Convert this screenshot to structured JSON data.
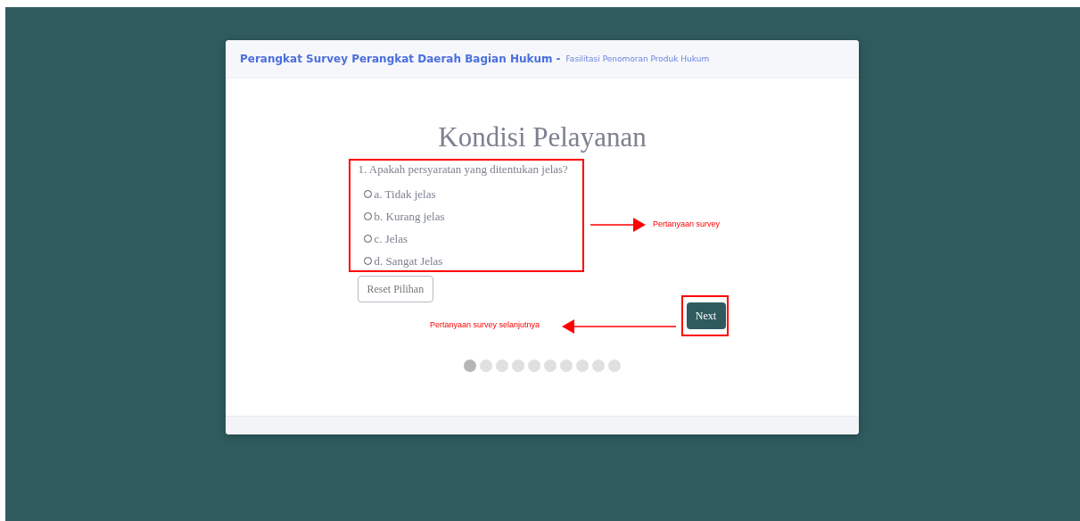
{
  "header": {
    "title": "Perangkat Survey Perangkat Daerah Bagian Hukum",
    "separator": "-",
    "subtitle": "Fasilitasi Penomoran Produk Hukum"
  },
  "section_title": "Kondisi Pelayanan",
  "question": {
    "text": "1. Apakah persyaratan yang ditentukan jelas?",
    "options": [
      {
        "label": "a. Tidak jelas",
        "selected": false
      },
      {
        "label": "b. Kurang jelas",
        "selected": false
      },
      {
        "label": "c. Jelas",
        "selected": false
      },
      {
        "label": "d. Sangat Jelas",
        "selected": false
      }
    ]
  },
  "reset_button": "Reset Pilihan",
  "next_button": "Next",
  "steps": [
    {
      "selected": true
    },
    {
      "selected": false
    },
    {
      "selected": false
    },
    {
      "selected": false
    },
    {
      "selected": false
    },
    {
      "selected": false
    },
    {
      "selected": false
    },
    {
      "selected": false
    },
    {
      "selected": false
    },
    {
      "selected": false
    }
  ],
  "annotations": [
    {
      "kind": "question",
      "label": "Pertanyaan survey",
      "points_right": true
    },
    {
      "kind": "next",
      "label": "Pertanyaan survey selanjutnya",
      "points_right": false
    }
  ]
}
